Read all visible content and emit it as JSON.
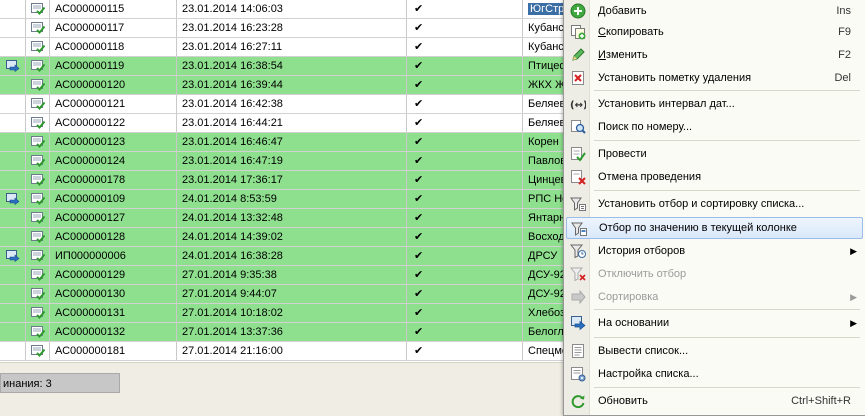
{
  "table": {
    "rows": [
      {
        "number": "АС000000115",
        "date": "23.01.2014 14:06:03",
        "check": "✔",
        "name": "ЮгСтро",
        "bg": "white",
        "mark": false,
        "highlight": true
      },
      {
        "number": "АС000000117",
        "date": "23.01.2014 16:23:28",
        "check": "✔",
        "name": "Кубанс",
        "bg": "white",
        "mark": false,
        "highlight": false
      },
      {
        "number": "АС000000118",
        "date": "23.01.2014 16:27:11",
        "check": "✔",
        "name": "Кубанс",
        "bg": "white",
        "mark": false,
        "highlight": false
      },
      {
        "number": "АС000000119",
        "date": "23.01.2014 16:38:54",
        "check": "✔",
        "name": "Птицеф",
        "bg": "green",
        "mark": true,
        "highlight": false
      },
      {
        "number": "АС000000120",
        "date": "23.01.2014 16:39:44",
        "check": "✔",
        "name": "ЖКХ Ж",
        "bg": "green",
        "mark": false,
        "highlight": false
      },
      {
        "number": "АС000000121",
        "date": "23.01.2014 16:42:38",
        "check": "✔",
        "name": "Беляев",
        "bg": "white",
        "mark": false,
        "highlight": false
      },
      {
        "number": "АС000000122",
        "date": "23.01.2014 16:44:21",
        "check": "✔",
        "name": "Беляев",
        "bg": "white",
        "mark": false,
        "highlight": false
      },
      {
        "number": "АС000000123",
        "date": "23.01.2014 16:46:47",
        "check": "✔",
        "name": "Корен",
        "bg": "green",
        "mark": false,
        "highlight": false
      },
      {
        "number": "АС000000124",
        "date": "23.01.2014 16:47:19",
        "check": "✔",
        "name": "Павлов",
        "bg": "green",
        "mark": false,
        "highlight": false
      },
      {
        "number": "АС000000178",
        "date": "23.01.2014 17:36:17",
        "check": "✔",
        "name": "Цинцев",
        "bg": "green",
        "mark": false,
        "highlight": false
      },
      {
        "number": "АС000000109",
        "date": "24.01.2014 8:53:59",
        "check": "✔",
        "name": "РПС Но",
        "bg": "green",
        "mark": true,
        "highlight": false
      },
      {
        "number": "АС000000127",
        "date": "24.01.2014 13:32:48",
        "check": "✔",
        "name": "Янтарн",
        "bg": "green",
        "mark": false,
        "highlight": false
      },
      {
        "number": "АС000000128",
        "date": "24.01.2014 14:39:02",
        "check": "✔",
        "name": "Восход",
        "bg": "green",
        "mark": false,
        "highlight": false
      },
      {
        "number": "ИП000000006",
        "date": "24.01.2014 16:38:28",
        "check": "✔",
        "name": "ДРСУ",
        "bg": "green",
        "mark": true,
        "highlight": false
      },
      {
        "number": "АС000000129",
        "date": "27.01.2014 9:35:38",
        "check": "✔",
        "name": "ДСУ-92",
        "bg": "green",
        "mark": false,
        "highlight": false
      },
      {
        "number": "АС000000130",
        "date": "27.01.2014 9:44:07",
        "check": "✔",
        "name": "ДСУ-92",
        "bg": "green",
        "mark": false,
        "highlight": false
      },
      {
        "number": "АС000000131",
        "date": "27.01.2014 10:18:02",
        "check": "✔",
        "name": "Хлебоз",
        "bg": "green",
        "mark": false,
        "highlight": false
      },
      {
        "number": "АС000000132",
        "date": "27.01.2014 13:37:36",
        "check": "✔",
        "name": "Белогл",
        "bg": "green",
        "mark": false,
        "highlight": false
      },
      {
        "number": "АС000000181",
        "date": "27.01.2014 21:16:00",
        "check": "✔",
        "name": "Спецме",
        "bg": "white",
        "mark": false,
        "highlight": false
      }
    ]
  },
  "status": {
    "text": "инания: 3"
  },
  "menu": {
    "items": [
      {
        "id": "add",
        "label": "Добавить",
        "ul": "Д",
        "rest": "обавить",
        "shortcut": "Ins",
        "icon": "add-icon",
        "top": 0
      },
      {
        "id": "copy",
        "label": "Скопировать",
        "ul": "С",
        "rest": "копировать",
        "shortcut": "F9",
        "icon": "copy-icon"
      },
      {
        "id": "edit",
        "label": "Изменить",
        "ul": "И",
        "rest": "зменить",
        "shortcut": "F2",
        "icon": "edit-icon"
      },
      {
        "id": "delete-mark",
        "label": "Установить пометку удаления",
        "shortcut": "Del",
        "icon": "delete-icon"
      },
      {
        "id": "date-interval",
        "label": "Установить интервал дат...",
        "icon": "date-interval-icon"
      },
      {
        "id": "search-number",
        "label": "Поиск по номеру...",
        "icon": "search-icon"
      },
      {
        "id": "post",
        "label": "Провести",
        "icon": "post-icon"
      },
      {
        "id": "unpost",
        "label": "Отмена проведения",
        "icon": "unpost-icon"
      },
      {
        "id": "set-filter",
        "label": "Установить отбор и сортировку списка...",
        "icon": "filter-sort-icon"
      },
      {
        "id": "filter-by-value",
        "label": "Отбор по значению в текущей колонке",
        "icon": "filter-value-icon"
      },
      {
        "id": "filter-history",
        "label": "История отборов",
        "icon": "filter-history-icon",
        "submenu": true
      },
      {
        "id": "disable-filter",
        "label": "Отключить отбор",
        "icon": "filter-off-icon",
        "disabled": true
      },
      {
        "id": "sort",
        "label": "Сортировка",
        "icon": "sort-icon",
        "submenu": true,
        "disabled": true
      },
      {
        "id": "based-on",
        "label": "На основании",
        "icon": "based-on-icon",
        "submenu": true
      },
      {
        "id": "export-list",
        "label": "Вывести список...",
        "icon": "export-list-icon"
      },
      {
        "id": "list-settings",
        "label": "Настройка списка...",
        "icon": "list-settings-icon"
      },
      {
        "id": "refresh",
        "label": "Обновить",
        "shortcut": "Ctrl+Shift+R",
        "icon": "refresh-icon"
      }
    ],
    "submenu_arrow": "▶"
  },
  "colors": {
    "row_green": "#8ee08e",
    "highlight": "#3a6ea5",
    "menu_hot": "#d9e8fa"
  }
}
